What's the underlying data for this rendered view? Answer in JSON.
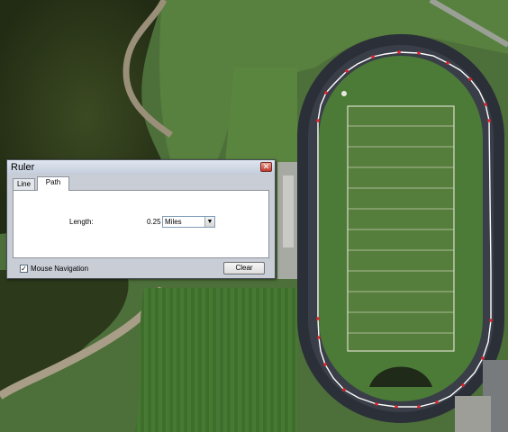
{
  "dialog": {
    "title": "Ruler",
    "close_glyph": "✕",
    "tabs": [
      {
        "label": "Line",
        "active": false
      },
      {
        "label": "Path",
        "active": true
      }
    ],
    "length_label": "Length:",
    "length_value": "0.25",
    "unit_selected": "Miles",
    "mouse_navigation_label": "Mouse Navigation",
    "mouse_navigation_checked": true,
    "check_glyph": "✓",
    "clear_label": "Clear"
  },
  "map": {
    "type": "aerial-imagery",
    "path_color": "#ffffff",
    "vertex_color": "#e0242a"
  },
  "icons": [
    "close-icon",
    "chevron-down-icon",
    "checkmark-icon"
  ]
}
